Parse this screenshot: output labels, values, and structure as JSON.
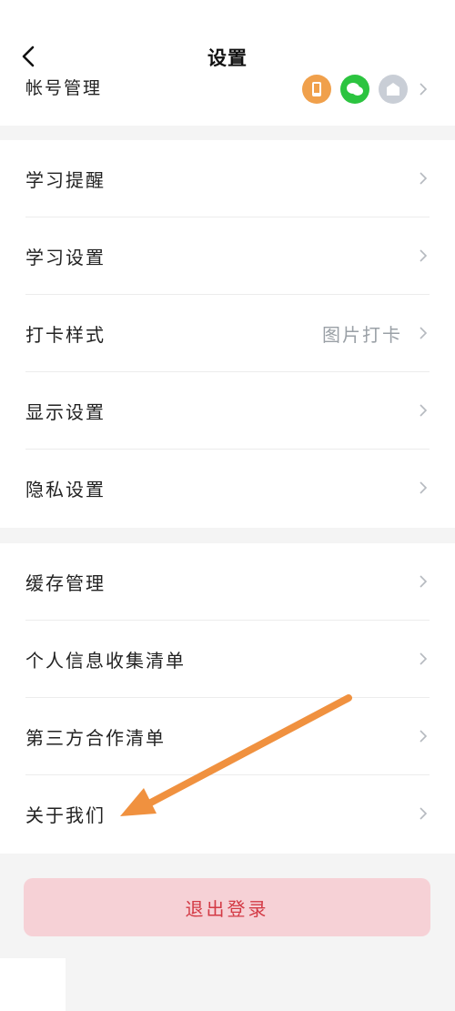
{
  "header": {
    "title": "设置",
    "back_icon": "chevron-left-icon"
  },
  "account": {
    "label": "帐号管理",
    "icons": [
      {
        "name": "phone-icon",
        "color": "#f0a04b"
      },
      {
        "name": "wechat-icon",
        "color": "#2cc440"
      },
      {
        "name": "more-account-icon",
        "color": "#c9ced6"
      }
    ]
  },
  "group1": [
    {
      "label": "学习提醒",
      "value": ""
    },
    {
      "label": "学习设置",
      "value": ""
    },
    {
      "label": "打卡样式",
      "value": "图片打卡"
    },
    {
      "label": "显示设置",
      "value": ""
    },
    {
      "label": "隐私设置",
      "value": ""
    }
  ],
  "group2": [
    {
      "label": "缓存管理"
    },
    {
      "label": "个人信息收集清单"
    },
    {
      "label": "第三方合作清单"
    },
    {
      "label": "关于我们"
    }
  ],
  "logout_label": "退出登录",
  "colors": {
    "accent_red": "#d33a45",
    "logout_bg": "#f6d1d6",
    "annotation_arrow": "#f0913f",
    "chevron": "#b5b9bf"
  }
}
